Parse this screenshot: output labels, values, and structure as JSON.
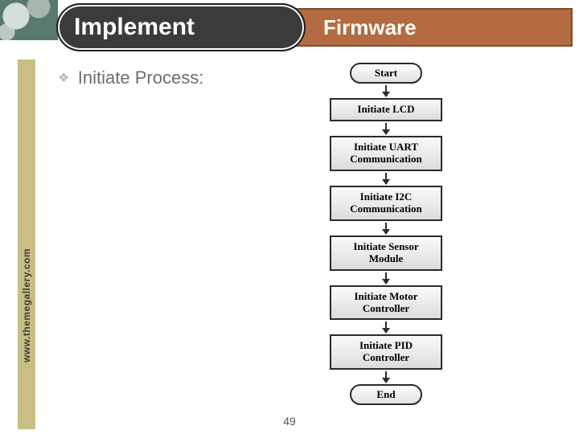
{
  "header": {
    "pill_title": "Implement",
    "banner_title": "Firmware"
  },
  "bullet": {
    "text": "Initiate Process:"
  },
  "sidebar": {
    "watermark": "www.themegallery.com"
  },
  "page": {
    "number": "49"
  },
  "chart_data": {
    "type": "flowchart",
    "direction": "top-to-bottom",
    "nodes": [
      {
        "id": "start",
        "shape": "terminator",
        "label": "Start"
      },
      {
        "id": "lcd",
        "shape": "process",
        "label": "Initiate LCD"
      },
      {
        "id": "uart",
        "shape": "process",
        "label": "Initiate UART\nCommunication"
      },
      {
        "id": "i2c",
        "shape": "process",
        "label": "Initiate I2C\nCommunication"
      },
      {
        "id": "sens",
        "shape": "process",
        "label": "Initiate Sensor\nModule"
      },
      {
        "id": "motor",
        "shape": "process",
        "label": "Initiate Motor\nController"
      },
      {
        "id": "pid",
        "shape": "process",
        "label": "Initiate PID\nController"
      },
      {
        "id": "end",
        "shape": "terminator",
        "label": "End"
      }
    ],
    "edges": [
      [
        "start",
        "lcd"
      ],
      [
        "lcd",
        "uart"
      ],
      [
        "uart",
        "i2c"
      ],
      [
        "i2c",
        "sens"
      ],
      [
        "sens",
        "motor"
      ],
      [
        "motor",
        "pid"
      ],
      [
        "pid",
        "end"
      ]
    ]
  }
}
